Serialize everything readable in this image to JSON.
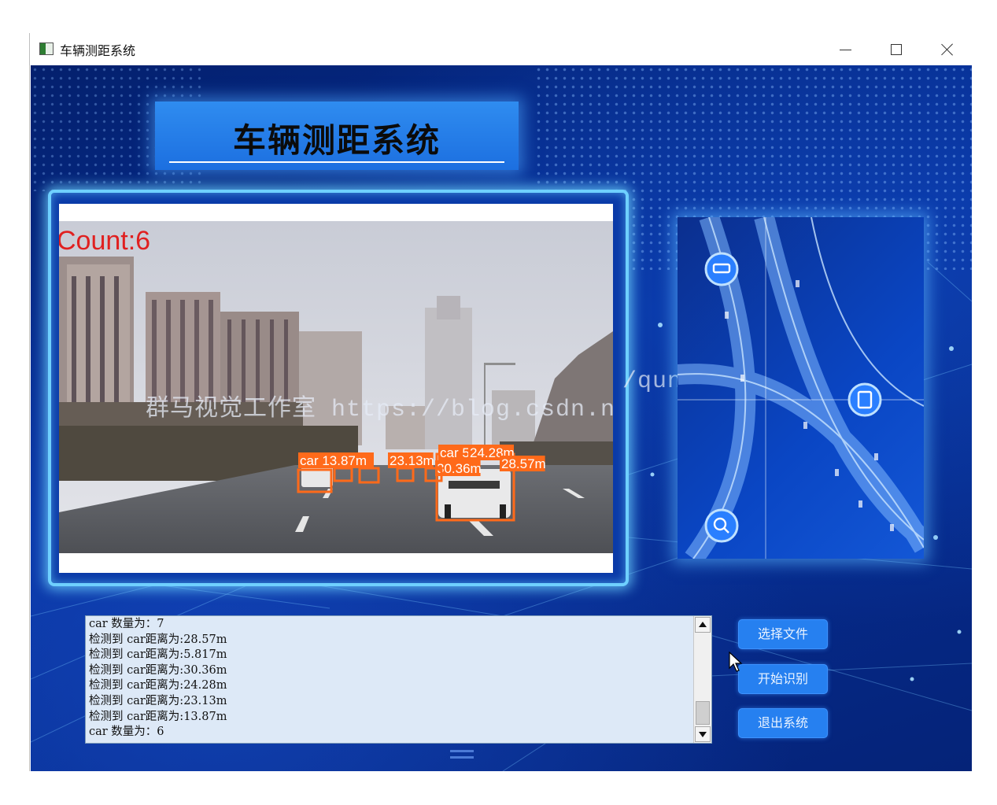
{
  "window": {
    "title": "车辆测距系统",
    "icon": "app-window-icon"
  },
  "header": {
    "title": "车辆测距系统"
  },
  "video": {
    "count_label": "Count:6",
    "watermark_left": "群马视觉工作室 https://blog.csdn.net/o",
    "watermark_right": "/qunshansj/work",
    "detections": [
      {
        "label": "car",
        "distance": "13.87m"
      },
      {
        "label": "",
        "distance": "23.13m"
      },
      {
        "label": "",
        "distance": "30.36m"
      },
      {
        "label": "car",
        "distance": "5.817m"
      },
      {
        "label": "",
        "distance": "24.28m"
      },
      {
        "label": "",
        "distance": "28.57m"
      }
    ]
  },
  "log": {
    "lines": [
      "car 数量为：7",
      "检测到 car距离为:28.57m",
      "检测到 car距离为:5.817m",
      "检测到 car距离为:30.36m",
      "检测到 car距离为:24.28m",
      "检测到 car距离为:23.13m",
      "检测到 car距离为:13.87m",
      "car 数量为：6"
    ]
  },
  "buttons": {
    "select_file": "选择文件",
    "start_recognition": "开始识别",
    "exit_system": "退出系统"
  },
  "colors": {
    "background": "#06309b",
    "title_panel": "#2a86f0",
    "frame_glow": "#6fd0ff",
    "button": "#2680f0",
    "detection_box": "#ff6a1a",
    "count_text": "#e02020",
    "log_bg": "#dde9f7"
  }
}
